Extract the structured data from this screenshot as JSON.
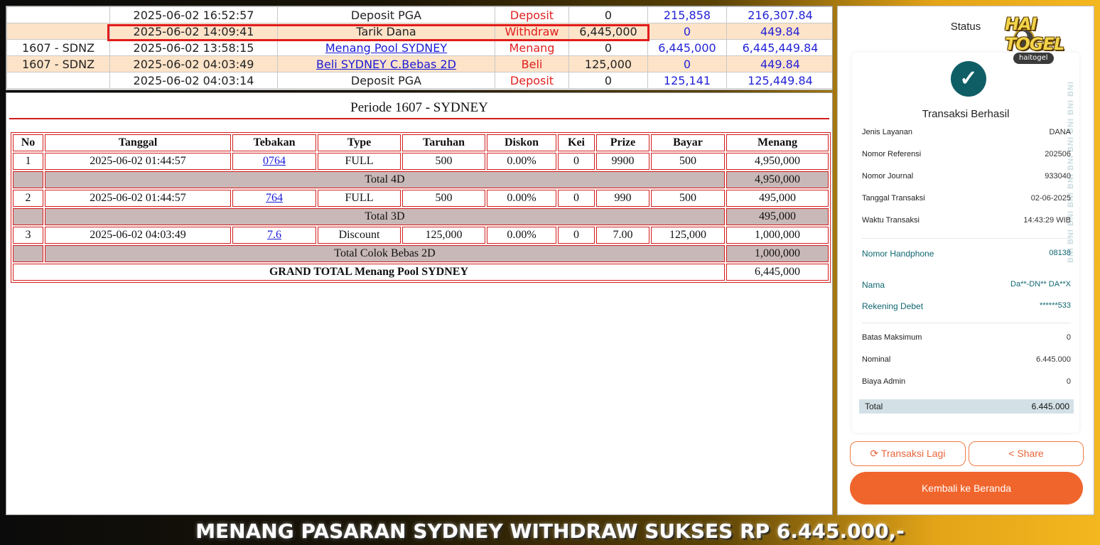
{
  "transactions": [
    {
      "invoice": "",
      "datetime": "2025-06-02 16:52:57",
      "desc": "Deposit PGA",
      "desc_link": false,
      "type": "Deposit",
      "debit": "0",
      "credit": "215,858",
      "balance": "216,307.84"
    },
    {
      "invoice": "",
      "datetime": "2025-06-02 14:09:41",
      "desc": "Tarik Dana",
      "desc_link": false,
      "type": "Withdraw",
      "debit": "6,445,000",
      "credit": "0",
      "balance": "449.84"
    },
    {
      "invoice": "1607 - SDNZ",
      "datetime": "2025-06-02 13:58:15",
      "desc": "Menang Pool SYDNEY",
      "desc_link": true,
      "type": "Menang",
      "debit": "0",
      "credit": "6,445,000",
      "balance": "6,445,449.84"
    },
    {
      "invoice": "1607 - SDNZ",
      "datetime": "2025-06-02 04:03:49",
      "desc": "Beli SYDNEY C.Bebas 2D",
      "desc_link": true,
      "type": "Beli",
      "debit": "125,000",
      "credit": "0",
      "balance": "449.84"
    },
    {
      "invoice": "",
      "datetime": "2025-06-02 04:03:14",
      "desc": "Deposit PGA",
      "desc_link": false,
      "type": "Deposit",
      "debit": "0",
      "credit": "125,141",
      "balance": "125,449.84"
    }
  ],
  "detail": {
    "title": "Periode 1607 - SYDNEY",
    "headers": [
      "No",
      "Tanggal",
      "Tebakan",
      "Type",
      "Taruhan",
      "Diskon",
      "Kei",
      "Prize",
      "Bayar",
      "Menang"
    ],
    "rows": [
      {
        "no": "1",
        "tanggal": "2025-06-02 01:44:57",
        "tebakan": "0764",
        "type": "FULL",
        "taruhan": "500",
        "diskon": "0.00%",
        "kei": "0",
        "prize": "9900",
        "bayar": "500",
        "menang": "4,950,000"
      },
      {
        "no": "2",
        "tanggal": "2025-06-02 01:44:57",
        "tebakan": "764",
        "type": "FULL",
        "taruhan": "500",
        "diskon": "0.00%",
        "kei": "0",
        "prize": "990",
        "bayar": "500",
        "menang": "495,000"
      },
      {
        "no": "3",
        "tanggal": "2025-06-02 04:03:49",
        "tebakan": "7.6",
        "type": "Discount",
        "taruhan": "125,000",
        "diskon": "0.00%",
        "kei": "0",
        "prize": "7.00",
        "bayar": "125,000",
        "menang": "1,000,000"
      }
    ],
    "subtotals": [
      {
        "label": "Total 4D",
        "value": "4,950,000"
      },
      {
        "label": "Total 3D",
        "value": "495,000"
      },
      {
        "label": "Total Colok Bebas 2D",
        "value": "1,000,000"
      }
    ],
    "grand_total_label": "GRAND TOTAL  Menang Pool SYDNEY",
    "grand_total_value": "6,445,000"
  },
  "receipt": {
    "header": "Status",
    "status": "Transaksi Berhasil",
    "check_icon": "✓",
    "fields": [
      {
        "label": "Jenis Layanan",
        "value": "DANA"
      },
      {
        "label": "Nomor Referensi",
        "value": "202506"
      },
      {
        "label": "Nomor Journal",
        "value": "933040"
      },
      {
        "label": "Tanggal Transaksi",
        "value": "02-06-2025"
      },
      {
        "label": "Waktu Transaksi",
        "value": "14:43:29 WIB"
      }
    ],
    "account_fields": [
      {
        "label": "Nomor Handphone",
        "value": "08138"
      },
      {
        "label": "Nama",
        "value": "Da**-DN** DA**X"
      },
      {
        "label": "Rekening Debet",
        "value": "******533"
      }
    ],
    "amount_fields": [
      {
        "label": "Batas Maksimum",
        "value": "0"
      },
      {
        "label": "Nominal",
        "value": "6.445.000"
      },
      {
        "label": "Biaya Admin",
        "value": "0"
      }
    ],
    "total_label": "Total",
    "total_value": "6.445.000",
    "watermark": "BNI BNI BNI BNI BNI BNI BNI BNI BNI BNI",
    "btn_again": "Transaksi Lagi",
    "btn_share": "Share",
    "btn_home": "Kembali ke Beranda"
  },
  "logo": {
    "text": "HAI TOGEL",
    "sub": "haitogel"
  },
  "banner": "MENANG PASARAN SYDNEY WITHDRAW SUKSES RP 6.445.000,-",
  "colors": {
    "highlight": "#e21b1b",
    "accent": "#f0652c",
    "teal": "#0f5e66"
  }
}
